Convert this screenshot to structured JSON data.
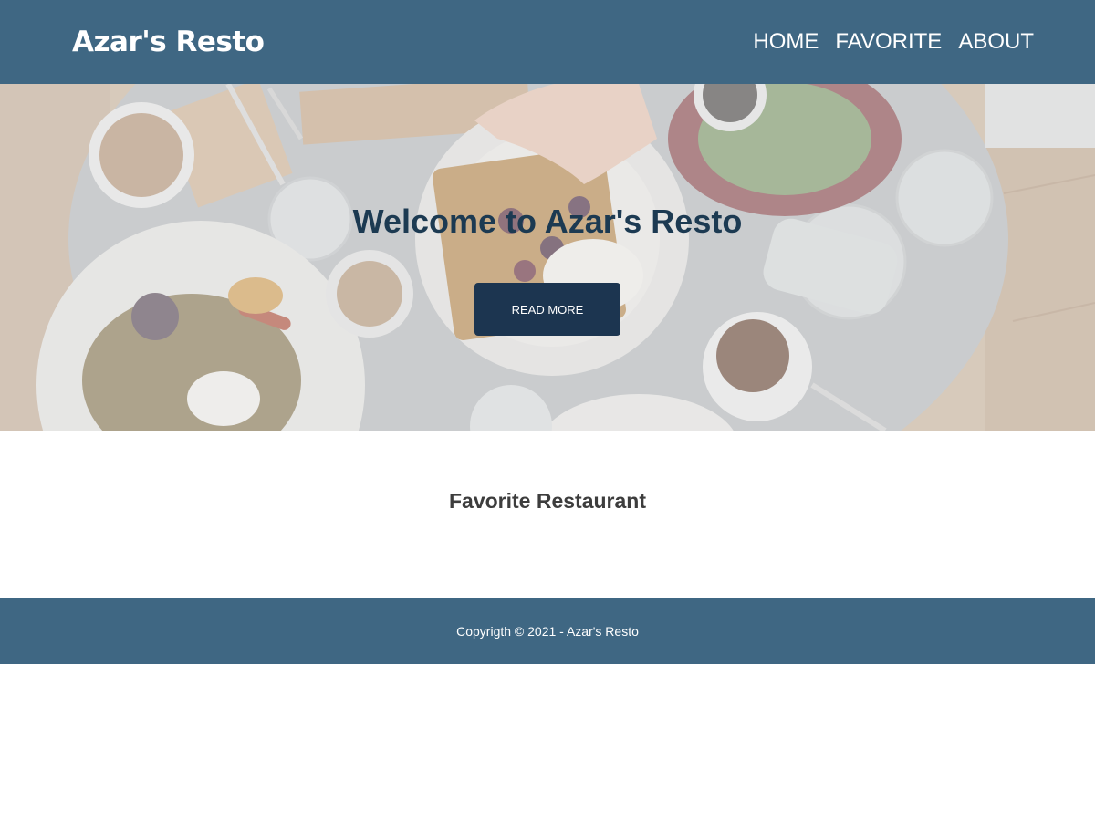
{
  "header": {
    "brand": "Azar's Resto",
    "nav": [
      "HOME",
      "FAVORITE",
      "ABOUT"
    ]
  },
  "hero": {
    "title": "Welcome to Azar's Resto",
    "button_label": "READ MORE",
    "image": "food-table-photo"
  },
  "main": {
    "section_title": "Favorite Restaurant"
  },
  "footer": {
    "copyright": "Copyrigth © 2021 - Azar's Resto"
  },
  "colors": {
    "header_bg": "#3f6783",
    "hero_title": "#1c3a52",
    "button_bg": "#1c3550",
    "footer_bg": "#3f6783"
  }
}
